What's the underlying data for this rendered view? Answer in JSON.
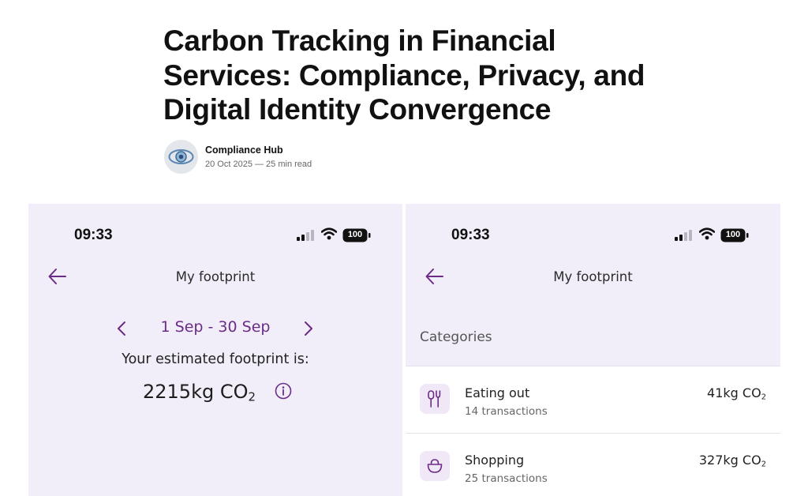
{
  "article": {
    "title": "Carbon Tracking in Financial Services: Compliance, Privacy, and Digital Identity Convergence",
    "author": "Compliance Hub",
    "meta": "20 Oct 2025 — 25 min read"
  },
  "left_screen": {
    "status": {
      "time": "09:33",
      "battery": "100"
    },
    "nav_title": "My footprint",
    "date_range": "1 Sep - 30 Sep",
    "footprint_label": "Your estimated footprint is:",
    "footprint_value": "2215kg CO",
    "footprint_sub": "2"
  },
  "right_screen": {
    "status": {
      "time": "09:33",
      "battery": "100"
    },
    "nav_title": "My footprint",
    "categories_heading": "Categories",
    "categories": [
      {
        "name": "Eating out",
        "transactions": "14 transactions",
        "amount": "41kg CO",
        "sub": "2",
        "icon": "cutlery-icon"
      },
      {
        "name": "Shopping",
        "transactions": "25 transactions",
        "amount": "327kg CO",
        "sub": "2",
        "icon": "shopping-bag-icon"
      }
    ]
  },
  "colors": {
    "accent": "#6b2c87",
    "phone_background": "#f1eef9",
    "icon_tile": "#f0e8f7"
  }
}
